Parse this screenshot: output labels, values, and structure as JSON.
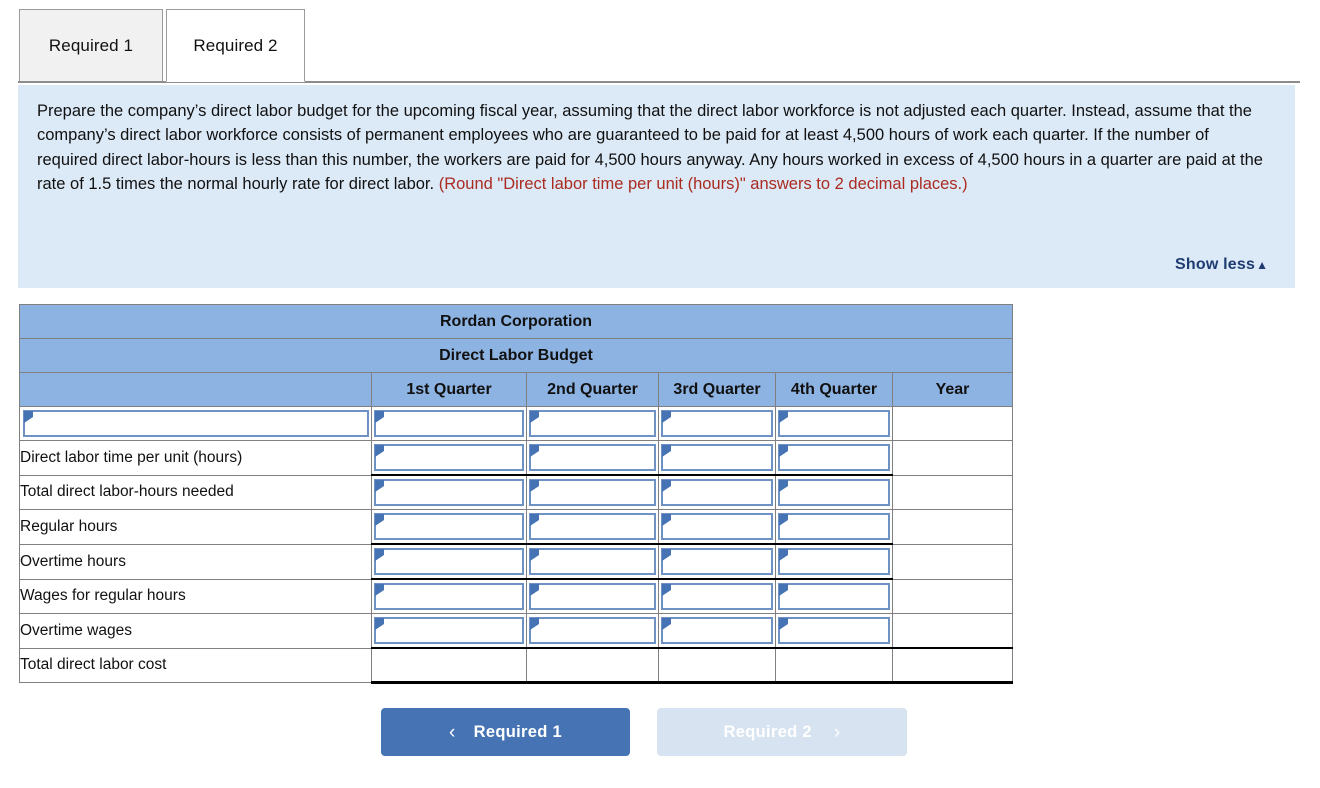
{
  "tabs": [
    {
      "label": "Required 1",
      "active": false
    },
    {
      "label": "Required 2",
      "active": true
    }
  ],
  "instructions": {
    "text_part1": "Prepare the company’s direct labor budget for the upcoming fiscal year, assuming that the direct labor workforce is not adjusted each quarter. Instead, assume that the company’s direct labor workforce consists of permanent employees who are guaranteed to be paid for at least 4,500 hours of work each quarter. If the number of required direct labor-hours is less than this number, the workers are paid for 4,500 hours anyway. Any hours worked in excess of 4,500 hours in a quarter are paid at the rate of 1.5 times the normal hourly rate for direct labor. ",
    "hint": "(Round \"Direct labor time per unit (hours)\" answers to 2 decimal places.)",
    "show_less_label": "Show less",
    "show_less_caret": "▲",
    "background_color": "#dce9f7",
    "hint_color": "#aa2b20",
    "link_color": "#1f3c72"
  },
  "table": {
    "company_title": "Rordan Corporation",
    "budget_title": "Direct Labor Budget",
    "header_color": "#8db3e2",
    "columns": [
      {
        "label": ""
      },
      {
        "label": "1st Quarter"
      },
      {
        "label": "2nd Quarter"
      },
      {
        "label": "3rd Quarter"
      },
      {
        "label": "4th Quarter"
      },
      {
        "label": "Year"
      }
    ],
    "rows": [
      {
        "label": "",
        "label_is_input": true,
        "inputs": [
          "",
          "",
          "",
          ""
        ],
        "year_value": ""
      },
      {
        "label": "Direct labor time per unit (hours)",
        "label_is_input": false,
        "inputs": [
          "",
          "",
          "",
          ""
        ],
        "year_value": ""
      },
      {
        "label": "Total direct labor-hours needed",
        "label_is_input": false,
        "inputs": [
          "",
          "",
          "",
          ""
        ],
        "year_value": ""
      },
      {
        "label": "Regular hours",
        "label_is_input": false,
        "inputs": [
          "",
          "",
          "",
          ""
        ],
        "year_value": ""
      },
      {
        "label": "Overtime hours",
        "label_is_input": false,
        "inputs": [
          "",
          "",
          "",
          ""
        ],
        "year_value": ""
      },
      {
        "label": "Wages for regular hours",
        "label_is_input": false,
        "inputs": [
          "",
          "",
          "",
          ""
        ],
        "year_value": ""
      },
      {
        "label": "Overtime wages",
        "label_is_input": false,
        "inputs": [
          "",
          "",
          "",
          ""
        ],
        "year_value": ""
      },
      {
        "label": "Total direct labor cost",
        "label_is_input": false,
        "inputs": [
          "",
          "",
          "",
          ""
        ],
        "year_value": ""
      }
    ]
  },
  "navigation": {
    "prev_label": "Required 1",
    "prev_chevron": "‹",
    "next_label": "Required 2",
    "next_chevron": "›",
    "prev_color": "#4573b4",
    "next_color": "#d7e3f0"
  }
}
